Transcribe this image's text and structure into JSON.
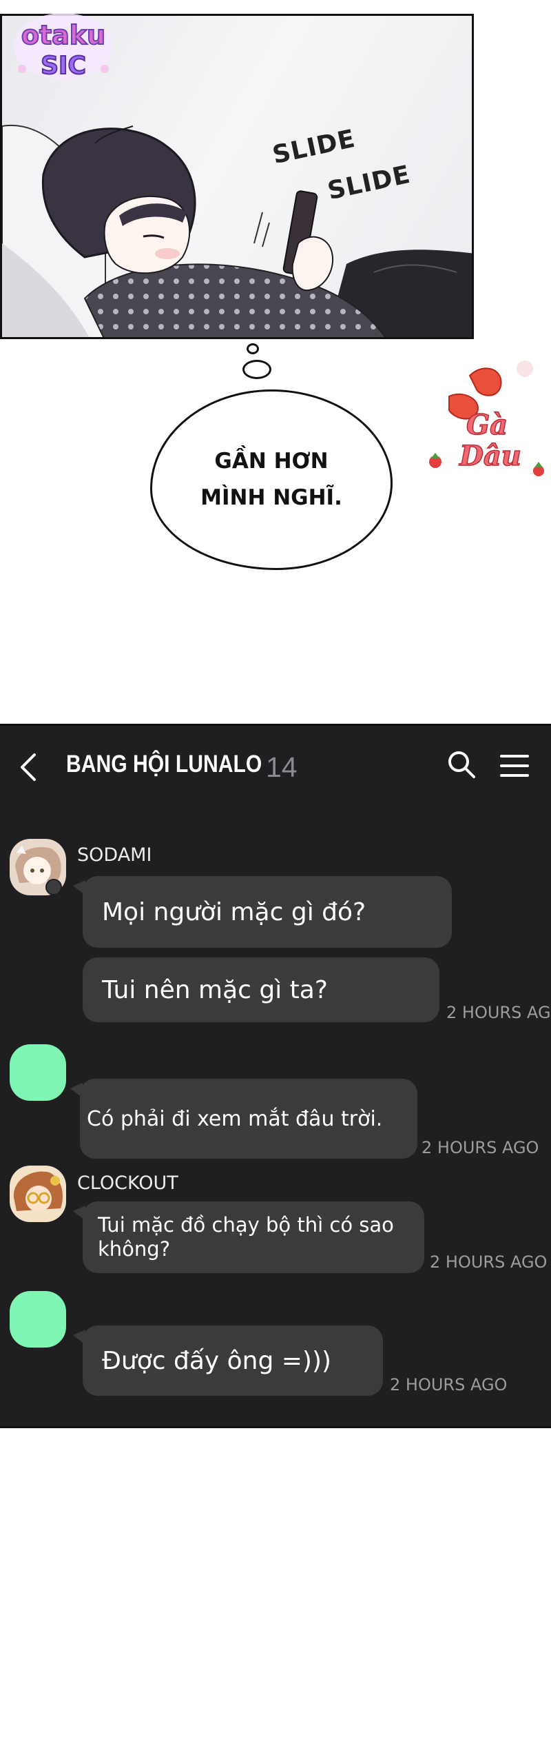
{
  "watermarks": {
    "top_left": "Otaku SIC",
    "right": "Gà Dâu"
  },
  "panel": {
    "sfx": [
      "SLIDE",
      "SLIDE"
    ]
  },
  "thought": {
    "lines": [
      "GẦN HƠN",
      "MÌNH NGHĨ."
    ]
  },
  "chat": {
    "title": "BANG HỘI LUNALO",
    "member_count": "14",
    "colors": {
      "background": "#1f1f21",
      "bubble": "#3b3b3e",
      "avatar_placeholder": "#7ff5b4"
    },
    "messages": [
      {
        "sender": "SODAMI",
        "avatar": "character-avatar",
        "text": "Mọi người mặc gì đó?",
        "time": ""
      },
      {
        "sender": "",
        "avatar": "",
        "text": "Tui nên mặc gì ta?",
        "time": "2 HOURS AG"
      },
      {
        "sender": "",
        "avatar": "green-placeholder-avatar",
        "text": "Có phải đi xem mắt đâu trời.",
        "time": "2 HOURS AGO"
      },
      {
        "sender": "CLOCKOUT",
        "avatar": "character-avatar",
        "text": "Tui mặc đồ chạy bộ thì có sao không?",
        "time": "2 HOURS AGO"
      },
      {
        "sender": "",
        "avatar": "green-placeholder-avatar",
        "text": "Được đấy ông =)))",
        "time": "2 HOURS AGO"
      }
    ]
  }
}
